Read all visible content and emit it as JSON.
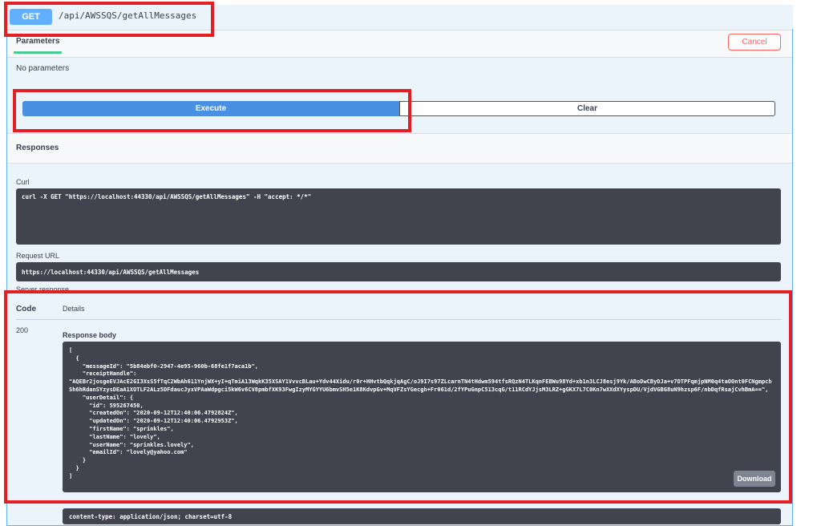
{
  "operation": {
    "method": "GET",
    "path": "/api/AWSSQS/getAllMessages"
  },
  "parameters": {
    "tab_label": "Parameters",
    "cancel_label": "Cancel",
    "empty_text": "No parameters"
  },
  "actions": {
    "execute_label": "Execute",
    "clear_label": "Clear"
  },
  "responses": {
    "title": "Responses",
    "curl_label": "Curl",
    "curl_command": "curl -X GET \"https://localhost:44330/api/AWSSQS/getAllMessages\" -H \"accept: */*\"",
    "request_url_label": "Request URL",
    "request_url": "https://localhost:44330/api/AWSSQS/getAllMessages",
    "server_response_label": "Server response",
    "code_header": "Code",
    "details_header": "Details",
    "status_code": "200",
    "response_body_label": "Response body",
    "response_body": "[\n  {\n    \"messageId\": \"5b84ebf0-2947-4e95-960b-68fe1f7aca1b\",\n    \"receiptHandle\":\n\"AQEBr2josgeEVJAcE2GI3XsS5fTqC2WbAh611YnjWX+yI+qTmiA13WqkK35XSAY1VvvcBLau+Ydv44Xidu/r0r+HHvtbQqkjqAgC/oJ9I7s97ZLcarnTN4tHdwm594tfsRQzN4TLKqnFEBWu98Yd+xb1n3LCJ8esj9Yk/ABoDwCByDJa+v7DTPFqmjpNM0q4taOOnt0FCNgmpchSh6hRdanSYzysDEaA1XOTLF2ALz5DFdaucJyxVPAaWdpgci5kW6v6CV8pmbfXK93FwgIzyMYGYYU6bmvSH5e1K8KdvpGv+MqVFZsYGecgh+Fr061d/2fYPuGnpC513cqG/t11RCdYJjsM3LRZ+gGKX7L7C0Kn7wXXdXYyspDU/VjdVGBG8uN9hzsp6F/nbDqfRsajCvhBmA==\",\n    \"userDetail\": {\n      \"id\": 595267450,\n      \"createdOn\": \"2020-09-12T12:40:06.4792824Z\",\n      \"updatedOn\": \"2020-09-12T12:40:06.4792953Z\",\n      \"firstName\": \"sprinkles\",\n      \"lastName\": \"lovely\",\n      \"userName\": \"sprinkles.lovely\",\n      \"emailId\": \"lovely@yahoo.com\"\n    }\n  }\n]",
    "download_label": "Download",
    "response_headers_value": "content-type: application/json; charset=utf-8"
  },
  "colors": {
    "get_method": "#61affe",
    "execute": "#4990e2",
    "cancel": "#ff6060",
    "annotation": "#e31e24",
    "code_bg": "#41444e"
  }
}
